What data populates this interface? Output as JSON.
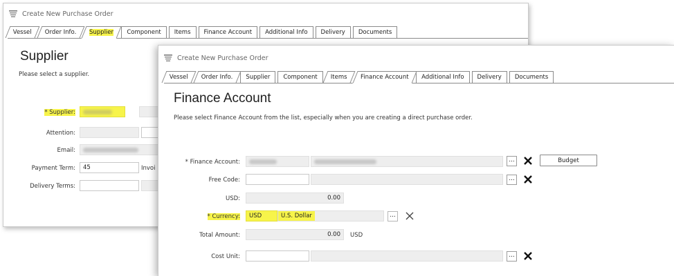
{
  "back_window": {
    "title": "Create New Purchase Order",
    "tabs": [
      "Vessel",
      "Order Info.",
      "Supplier",
      "Component",
      "Items",
      "Finance Account",
      "Additional Info",
      "Delivery",
      "Documents"
    ],
    "active_tab": "Supplier",
    "heading": "Supplier",
    "hint": "Please select a supplier.",
    "fields": {
      "supplier_label": "* Supplier:",
      "attention_label": "Attention:",
      "email_label": "Email:",
      "payment_term_label": "Payment Term:",
      "payment_term_value": "45",
      "payment_term_suffix": "Invoi",
      "delivery_terms_label": "Delivery Terms:"
    }
  },
  "front_window": {
    "title": "Create New Purchase Order",
    "tabs": [
      "Vessel",
      "Order Info.",
      "Supplier",
      "Component",
      "Items",
      "Finance Account",
      "Additional Info",
      "Delivery",
      "Documents"
    ],
    "active_tab": "Finance Account",
    "heading": "Finance Account",
    "hint": "Please select Finance Account from the list, especially when you are creating a direct purchase order.",
    "fields": {
      "finance_account_label": "* Finance Account:",
      "free_code_label": "Free Code:",
      "usd_label": "USD:",
      "usd_value": "0.00",
      "currency_label": "* Currency:",
      "currency_code": "USD",
      "currency_name": "U.S. Dollar",
      "total_amount_label": "Total Amount:",
      "total_amount_value": "0.00",
      "total_amount_unit": "USD",
      "cost_unit_label": "Cost Unit:",
      "dots_label": "...",
      "budget_button_label": "Budget"
    }
  },
  "colors": {
    "highlight": "#f7f44a",
    "readonly_field": "#eeeeee",
    "border": "#c8c8c8"
  },
  "icons": [
    "cart-icon",
    "clear-x-icon",
    "browse-dots-icon"
  ]
}
